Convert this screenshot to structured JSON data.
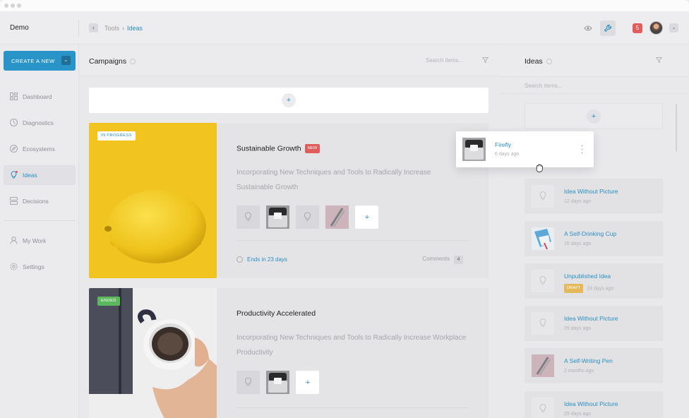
{
  "topbar": {
    "brand": "Demo",
    "breadcrumb": [
      "Tools",
      "Ideas"
    ],
    "breadcrumb_sep": "›",
    "notifications_count": "5"
  },
  "sidebar": {
    "create_label": "CREATE A NEW",
    "nav": [
      {
        "label": "Dashboard",
        "icon": "dashboard-icon"
      },
      {
        "label": "Diagnostics",
        "icon": "diagnostics-icon"
      },
      {
        "label": "Ecosystems",
        "icon": "ecosystems-icon"
      },
      {
        "label": "Ideas",
        "icon": "lightbulb-icon",
        "active": true
      },
      {
        "label": "Decisions",
        "icon": "decisions-icon"
      },
      {
        "label": "My Work",
        "icon": "user-icon"
      },
      {
        "label": "Settings",
        "icon": "gear-icon"
      }
    ]
  },
  "campaigns": {
    "title": "Campaigns",
    "search_placeholder": "Search items...",
    "add_symbol": "+",
    "cards": [
      {
        "status": "IN PROGRESS",
        "title": "Sustainable Growth",
        "badge": "NEW",
        "description": "Incorporating New Techniques and Tools to Radically Increase Sustainable Growth",
        "ends": "Ends in 23 days",
        "comments_label": "Comments",
        "comments_count": "4"
      },
      {
        "status": "ENDED",
        "title": "Productivity Accelerated",
        "description": "Incorporating New Techniques and Tools to Radically Increase Workplace Productivity"
      }
    ]
  },
  "ideas": {
    "title": "Ideas",
    "search_placeholder": "Search items...",
    "dragging": {
      "title": "Firefly",
      "age": "6 days ago"
    },
    "items": [
      {
        "title": "Idea Without Picture",
        "age": "12 days ago"
      },
      {
        "title": "A Self-Drinking Cup",
        "age": "16 days ago"
      },
      {
        "title": "Unpublished Idea",
        "badge": "DRAFT",
        "age": "24 days ago"
      },
      {
        "title": "Idea Without Picture",
        "age": "29 days ago"
      },
      {
        "title": "A Self-Writing Pen",
        "age": "2 months ago"
      },
      {
        "title": "Idea Without Picture",
        "age": "29 days ago"
      }
    ]
  },
  "colors": {
    "accent": "#2994c8",
    "new_badge": "#e35c5c",
    "draft_badge": "#e4b95b",
    "ended_badge": "#5cb85c",
    "lemon_bg": "#f3c623"
  }
}
